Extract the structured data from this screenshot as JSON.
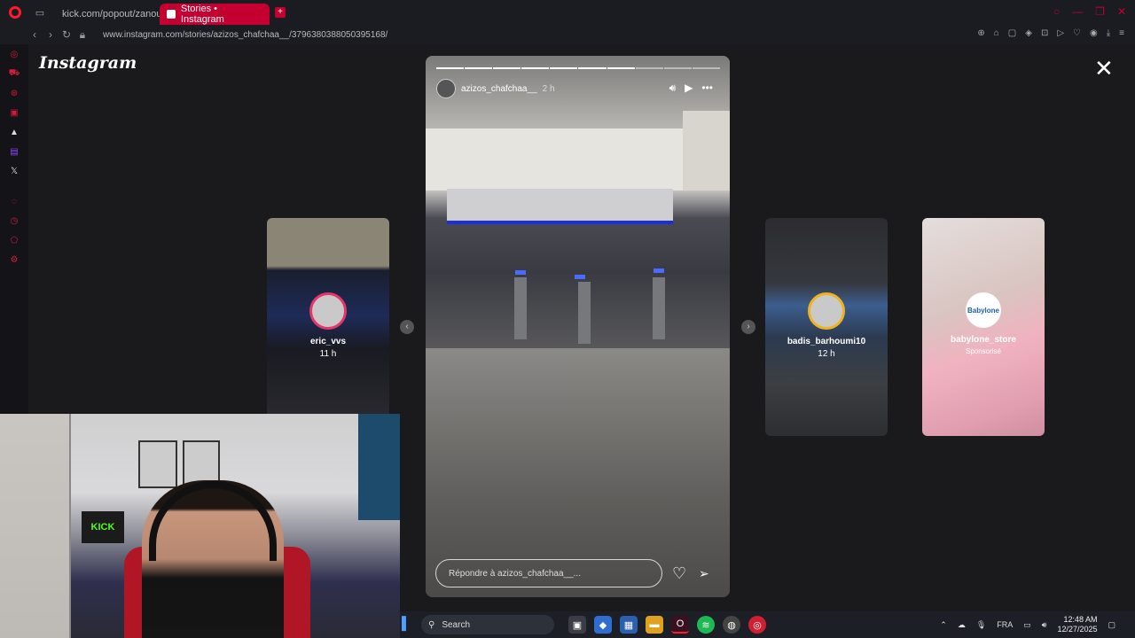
{
  "browser": {
    "tabs": [
      {
        "label": "kick.com/popout/zanoun",
        "active": false
      },
      {
        "label": "Stories • Instagram",
        "active": true
      }
    ],
    "new_tab": "+",
    "url": "www.instagram.com/stories/azizos_chafchaa__/3796380388050395168/",
    "accent": "#c3002f"
  },
  "instagram": {
    "logo": "Instagram",
    "close": "✕"
  },
  "story": {
    "username": "azizos_chafchaa__",
    "time": "2 h",
    "progress_segments": 10,
    "progress_done": 7,
    "reply_placeholder": "Répondre à azizos_chafchaa__...",
    "icons": [
      "volume-icon",
      "play-icon",
      "more-icon",
      "heart-icon",
      "send-icon"
    ]
  },
  "previews": {
    "left": {
      "name": "eric_vvs",
      "time": "11 h",
      "avatar_ring": "#e6356a"
    },
    "right1": {
      "name": "badis_barhoumi10",
      "time": "12 h",
      "avatar_ring": "#f2b21e"
    },
    "right2": {
      "name": "babylone_store",
      "time": "Sponsorisé",
      "brand_logo": "Babylone"
    }
  },
  "webcam": {
    "sign": "KICK"
  },
  "taskbar": {
    "search": "Search",
    "language": "FRA",
    "time": "12:48 AM",
    "date": "12/27/2025"
  }
}
